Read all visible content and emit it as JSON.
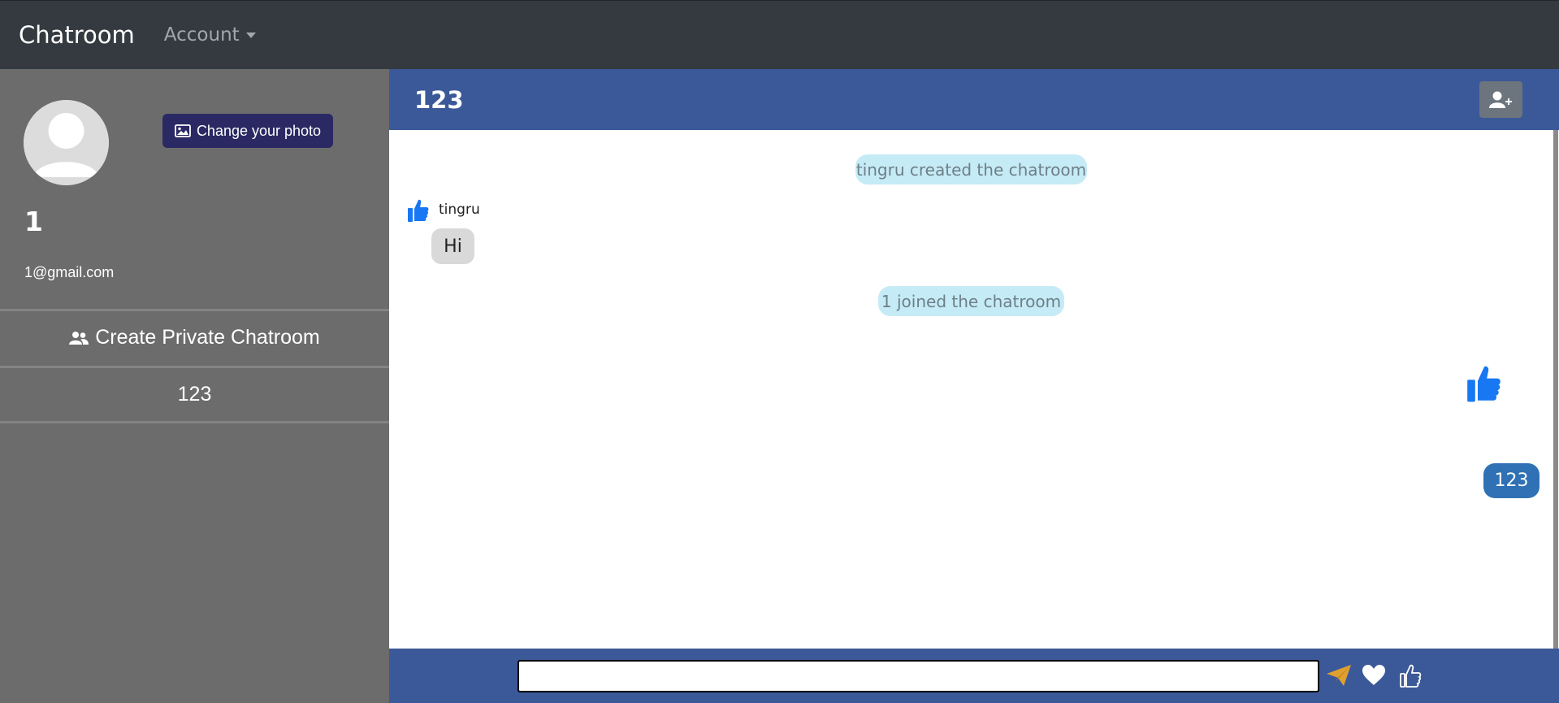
{
  "navbar": {
    "brand": "Chatroom",
    "account_label": "Account"
  },
  "sidebar": {
    "change_photo_label": "Change your photo",
    "user_name": "1",
    "user_email": "1@gmail.com",
    "create_private_label": "Create Private Chatroom",
    "rooms": [
      "123"
    ]
  },
  "chat": {
    "title": "123",
    "messages": {
      "system_created": "tingru created the chatroom",
      "sender_name": "tingru",
      "sender_text": "Hi",
      "system_joined": "1 joined the chatroom",
      "own_text": "123"
    }
  },
  "input": {
    "value": "",
    "placeholder": ""
  },
  "icons": {
    "send": "paper-plane-icon",
    "heart": "heart-icon",
    "like": "thumbs-up-icon",
    "add_user": "user-plus-icon",
    "create_group": "users-icon",
    "image": "image-icon"
  },
  "colors": {
    "navbar": "#343a40",
    "sidebar": "#6c6c6c",
    "header": "#3b5998",
    "photo_button": "#2b2963",
    "system_message": "#c5ebf6",
    "own_bubble": "#2f71b4",
    "like_blue": "#1877f2",
    "send_orange": "#e0a030"
  }
}
